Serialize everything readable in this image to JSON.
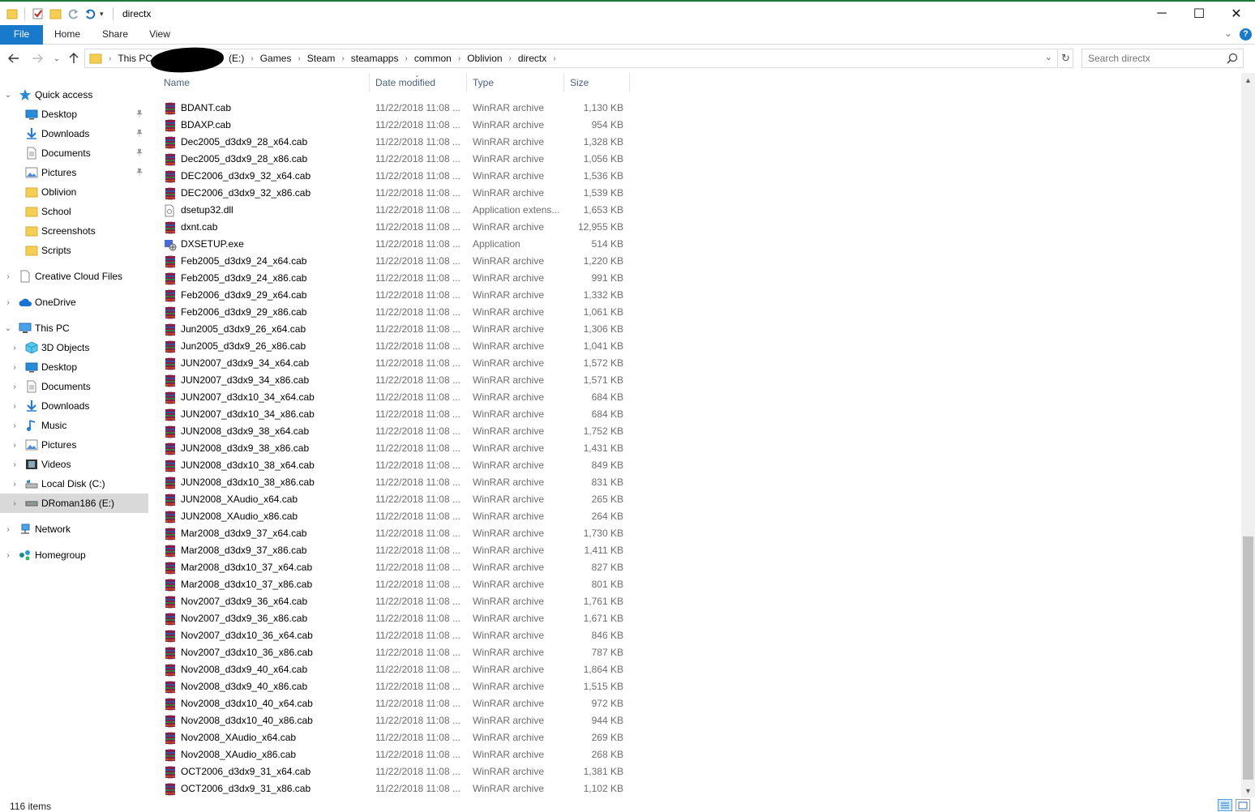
{
  "window": {
    "title": "directx",
    "minimize": "─",
    "maximize": "☐",
    "close": "✕"
  },
  "ribbon": {
    "tabs": [
      "File",
      "Home",
      "Share",
      "View"
    ],
    "help": "?"
  },
  "address": {
    "crumbs": [
      "This PC",
      "(E:)",
      "Games",
      "Steam",
      "steamapps",
      "common",
      "Oblivion",
      "directx"
    ]
  },
  "search": {
    "placeholder": "Search directx"
  },
  "nav": {
    "quick_access": "Quick access",
    "quick_items": [
      {
        "label": "Desktop",
        "icon": "desktop-icon",
        "pinned": true
      },
      {
        "label": "Downloads",
        "icon": "download-icon",
        "pinned": true
      },
      {
        "label": "Documents",
        "icon": "documents-icon",
        "pinned": true
      },
      {
        "label": "Pictures",
        "icon": "pictures-icon",
        "pinned": true
      },
      {
        "label": "Oblivion",
        "icon": "folder-icon",
        "pinned": false
      },
      {
        "label": "School",
        "icon": "folder-icon",
        "pinned": false
      },
      {
        "label": "Screenshots",
        "icon": "folder-icon",
        "pinned": false
      },
      {
        "label": "Scripts",
        "icon": "folder-icon",
        "pinned": false
      }
    ],
    "creative_cloud": "Creative Cloud Files",
    "onedrive": "OneDrive",
    "this_pc": "This PC",
    "pc_items": [
      {
        "label": "3D Objects",
        "icon": "3d-objects-icon"
      },
      {
        "label": "Desktop",
        "icon": "desktop-icon"
      },
      {
        "label": "Documents",
        "icon": "documents-icon"
      },
      {
        "label": "Downloads",
        "icon": "download-icon"
      },
      {
        "label": "Music",
        "icon": "music-icon"
      },
      {
        "label": "Pictures",
        "icon": "pictures-icon"
      },
      {
        "label": "Videos",
        "icon": "videos-icon"
      },
      {
        "label": "Local Disk (C:)",
        "icon": "local-disk-icon"
      },
      {
        "label": "DRoman186 (E:)",
        "icon": "drive-icon"
      }
    ],
    "network": "Network",
    "homegroup": "Homegroup"
  },
  "columns": {
    "name": "Name",
    "date": "Date modified",
    "type": "Type",
    "size": "Size"
  },
  "files": [
    {
      "name": "BDANT.cab",
      "date": "11/22/2018 11:08 ...",
      "type": "WinRAR archive",
      "size": "1,130 KB",
      "icon": "winrar-icon"
    },
    {
      "name": "BDAXP.cab",
      "date": "11/22/2018 11:08 ...",
      "type": "WinRAR archive",
      "size": "954 KB",
      "icon": "winrar-icon"
    },
    {
      "name": "Dec2005_d3dx9_28_x64.cab",
      "date": "11/22/2018 11:08 ...",
      "type": "WinRAR archive",
      "size": "1,328 KB",
      "icon": "winrar-icon"
    },
    {
      "name": "Dec2005_d3dx9_28_x86.cab",
      "date": "11/22/2018 11:08 ...",
      "type": "WinRAR archive",
      "size": "1,056 KB",
      "icon": "winrar-icon"
    },
    {
      "name": "DEC2006_d3dx9_32_x64.cab",
      "date": "11/22/2018 11:08 ...",
      "type": "WinRAR archive",
      "size": "1,536 KB",
      "icon": "winrar-icon"
    },
    {
      "name": "DEC2006_d3dx9_32_x86.cab",
      "date": "11/22/2018 11:08 ...",
      "type": "WinRAR archive",
      "size": "1,539 KB",
      "icon": "winrar-icon"
    },
    {
      "name": "dsetup32.dll",
      "date": "11/22/2018 11:08 ...",
      "type": "Application extens...",
      "size": "1,653 KB",
      "icon": "dll-icon"
    },
    {
      "name": "dxnt.cab",
      "date": "11/22/2018 11:08 ...",
      "type": "WinRAR archive",
      "size": "12,955 KB",
      "icon": "winrar-icon"
    },
    {
      "name": "DXSETUP.exe",
      "date": "11/22/2018 11:08 ...",
      "type": "Application",
      "size": "514 KB",
      "icon": "exe-icon"
    },
    {
      "name": "Feb2005_d3dx9_24_x64.cab",
      "date": "11/22/2018 11:08 ...",
      "type": "WinRAR archive",
      "size": "1,220 KB",
      "icon": "winrar-icon"
    },
    {
      "name": "Feb2005_d3dx9_24_x86.cab",
      "date": "11/22/2018 11:08 ...",
      "type": "WinRAR archive",
      "size": "991 KB",
      "icon": "winrar-icon"
    },
    {
      "name": "Feb2006_d3dx9_29_x64.cab",
      "date": "11/22/2018 11:08 ...",
      "type": "WinRAR archive",
      "size": "1,332 KB",
      "icon": "winrar-icon"
    },
    {
      "name": "Feb2006_d3dx9_29_x86.cab",
      "date": "11/22/2018 11:08 ...",
      "type": "WinRAR archive",
      "size": "1,061 KB",
      "icon": "winrar-icon"
    },
    {
      "name": "Jun2005_d3dx9_26_x64.cab",
      "date": "11/22/2018 11:08 ...",
      "type": "WinRAR archive",
      "size": "1,306 KB",
      "icon": "winrar-icon"
    },
    {
      "name": "Jun2005_d3dx9_26_x86.cab",
      "date": "11/22/2018 11:08 ...",
      "type": "WinRAR archive",
      "size": "1,041 KB",
      "icon": "winrar-icon"
    },
    {
      "name": "JUN2007_d3dx9_34_x64.cab",
      "date": "11/22/2018 11:08 ...",
      "type": "WinRAR archive",
      "size": "1,572 KB",
      "icon": "winrar-icon"
    },
    {
      "name": "JUN2007_d3dx9_34_x86.cab",
      "date": "11/22/2018 11:08 ...",
      "type": "WinRAR archive",
      "size": "1,571 KB",
      "icon": "winrar-icon"
    },
    {
      "name": "JUN2007_d3dx10_34_x64.cab",
      "date": "11/22/2018 11:08 ...",
      "type": "WinRAR archive",
      "size": "684 KB",
      "icon": "winrar-icon"
    },
    {
      "name": "JUN2007_d3dx10_34_x86.cab",
      "date": "11/22/2018 11:08 ...",
      "type": "WinRAR archive",
      "size": "684 KB",
      "icon": "winrar-icon"
    },
    {
      "name": "JUN2008_d3dx9_38_x64.cab",
      "date": "11/22/2018 11:08 ...",
      "type": "WinRAR archive",
      "size": "1,752 KB",
      "icon": "winrar-icon"
    },
    {
      "name": "JUN2008_d3dx9_38_x86.cab",
      "date": "11/22/2018 11:08 ...",
      "type": "WinRAR archive",
      "size": "1,431 KB",
      "icon": "winrar-icon"
    },
    {
      "name": "JUN2008_d3dx10_38_x64.cab",
      "date": "11/22/2018 11:08 ...",
      "type": "WinRAR archive",
      "size": "849 KB",
      "icon": "winrar-icon"
    },
    {
      "name": "JUN2008_d3dx10_38_x86.cab",
      "date": "11/22/2018 11:08 ...",
      "type": "WinRAR archive",
      "size": "831 KB",
      "icon": "winrar-icon"
    },
    {
      "name": "JUN2008_XAudio_x64.cab",
      "date": "11/22/2018 11:08 ...",
      "type": "WinRAR archive",
      "size": "265 KB",
      "icon": "winrar-icon"
    },
    {
      "name": "JUN2008_XAudio_x86.cab",
      "date": "11/22/2018 11:08 ...",
      "type": "WinRAR archive",
      "size": "264 KB",
      "icon": "winrar-icon"
    },
    {
      "name": "Mar2008_d3dx9_37_x64.cab",
      "date": "11/22/2018 11:08 ...",
      "type": "WinRAR archive",
      "size": "1,730 KB",
      "icon": "winrar-icon"
    },
    {
      "name": "Mar2008_d3dx9_37_x86.cab",
      "date": "11/22/2018 11:08 ...",
      "type": "WinRAR archive",
      "size": "1,411 KB",
      "icon": "winrar-icon"
    },
    {
      "name": "Mar2008_d3dx10_37_x64.cab",
      "date": "11/22/2018 11:08 ...",
      "type": "WinRAR archive",
      "size": "827 KB",
      "icon": "winrar-icon"
    },
    {
      "name": "Mar2008_d3dx10_37_x86.cab",
      "date": "11/22/2018 11:08 ...",
      "type": "WinRAR archive",
      "size": "801 KB",
      "icon": "winrar-icon"
    },
    {
      "name": "Nov2007_d3dx9_36_x64.cab",
      "date": "11/22/2018 11:08 ...",
      "type": "WinRAR archive",
      "size": "1,761 KB",
      "icon": "winrar-icon"
    },
    {
      "name": "Nov2007_d3dx9_36_x86.cab",
      "date": "11/22/2018 11:08 ...",
      "type": "WinRAR archive",
      "size": "1,671 KB",
      "icon": "winrar-icon"
    },
    {
      "name": "Nov2007_d3dx10_36_x64.cab",
      "date": "11/22/2018 11:08 ...",
      "type": "WinRAR archive",
      "size": "846 KB",
      "icon": "winrar-icon"
    },
    {
      "name": "Nov2007_d3dx10_36_x86.cab",
      "date": "11/22/2018 11:08 ...",
      "type": "WinRAR archive",
      "size": "787 KB",
      "icon": "winrar-icon"
    },
    {
      "name": "Nov2008_d3dx9_40_x64.cab",
      "date": "11/22/2018 11:08 ...",
      "type": "WinRAR archive",
      "size": "1,864 KB",
      "icon": "winrar-icon"
    },
    {
      "name": "Nov2008_d3dx9_40_x86.cab",
      "date": "11/22/2018 11:08 ...",
      "type": "WinRAR archive",
      "size": "1,515 KB",
      "icon": "winrar-icon"
    },
    {
      "name": "Nov2008_d3dx10_40_x64.cab",
      "date": "11/22/2018 11:08 ...",
      "type": "WinRAR archive",
      "size": "972 KB",
      "icon": "winrar-icon"
    },
    {
      "name": "Nov2008_d3dx10_40_x86.cab",
      "date": "11/22/2018 11:08 ...",
      "type": "WinRAR archive",
      "size": "944 KB",
      "icon": "winrar-icon"
    },
    {
      "name": "Nov2008_XAudio_x64.cab",
      "date": "11/22/2018 11:08 ...",
      "type": "WinRAR archive",
      "size": "269 KB",
      "icon": "winrar-icon"
    },
    {
      "name": "Nov2008_XAudio_x86.cab",
      "date": "11/22/2018 11:08 ...",
      "type": "WinRAR archive",
      "size": "268 KB",
      "icon": "winrar-icon"
    },
    {
      "name": "OCT2006_d3dx9_31_x64.cab",
      "date": "11/22/2018 11:08 ...",
      "type": "WinRAR archive",
      "size": "1,381 KB",
      "icon": "winrar-icon"
    },
    {
      "name": "OCT2006_d3dx9_31_x86.cab",
      "date": "11/22/2018 11:08 ...",
      "type": "WinRAR archive",
      "size": "1,102 KB",
      "icon": "winrar-icon"
    }
  ],
  "status": {
    "count": "116 items"
  },
  "colors": {
    "accent": "#1979ca",
    "selection": "#cce8ff",
    "header_text": "#4c607a",
    "secondary_text": "#6d6d6d"
  }
}
